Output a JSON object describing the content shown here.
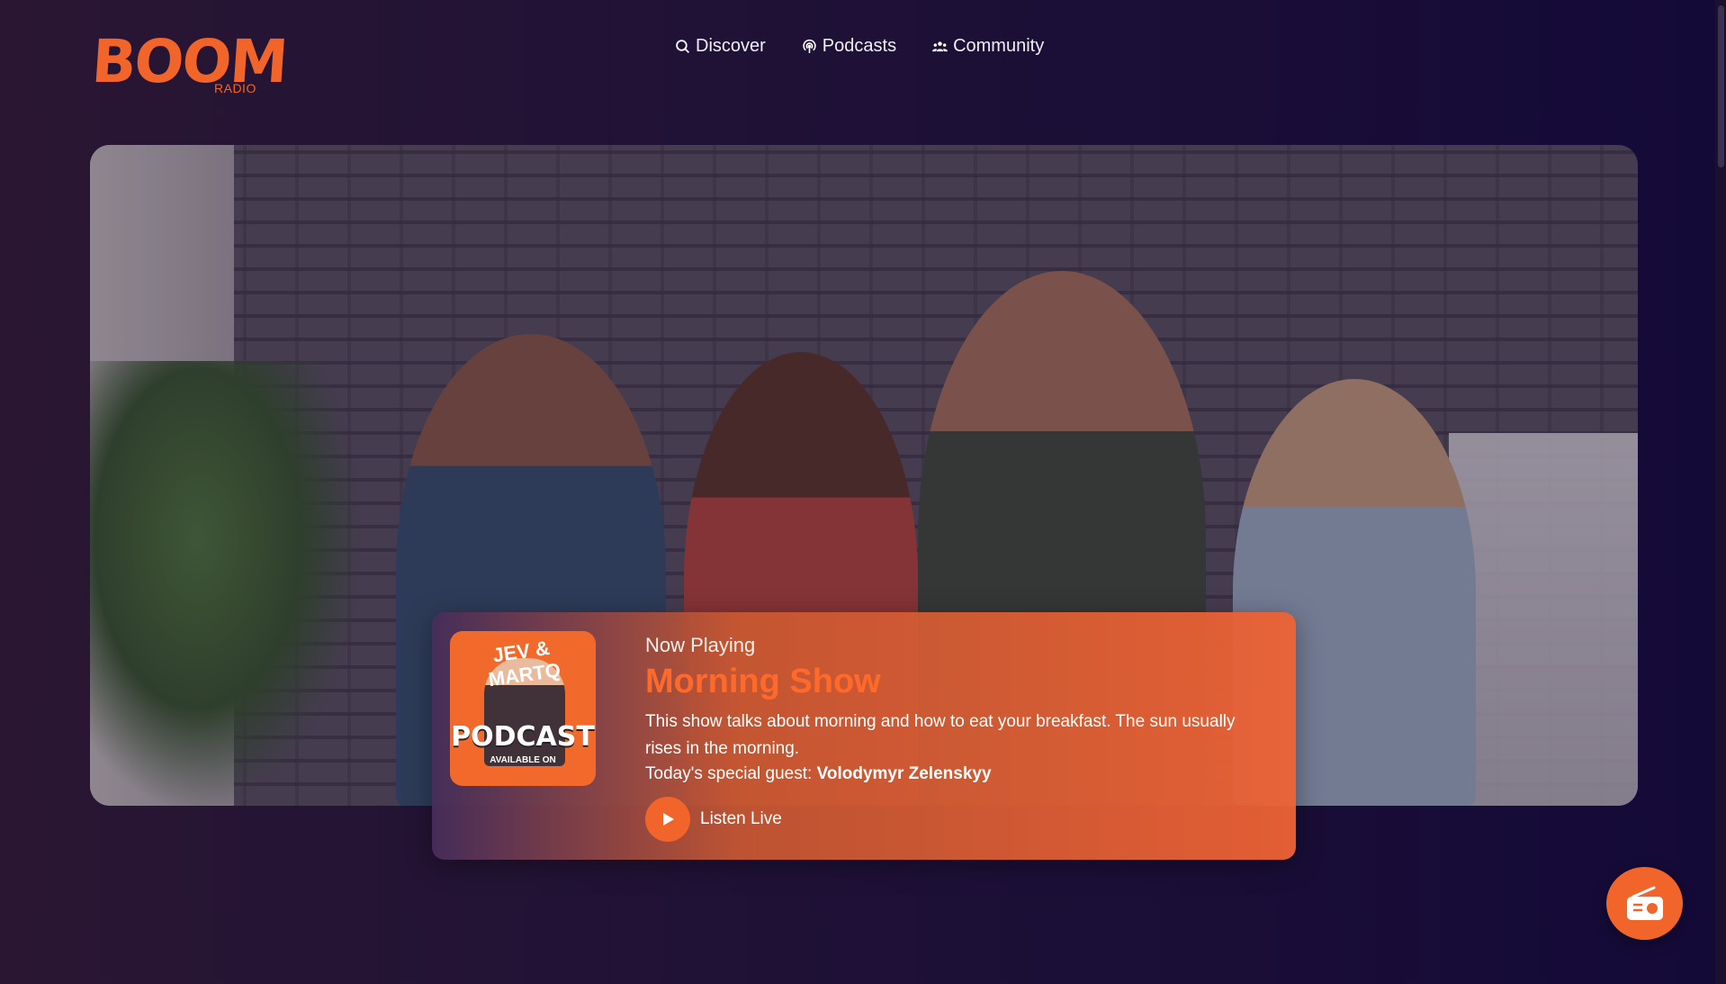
{
  "brand": {
    "logo_text": "BOOM",
    "logo_subtext": "RADIO",
    "accent_color": "#f2652a"
  },
  "nav": {
    "items": [
      {
        "label": "Discover",
        "icon": "search-icon"
      },
      {
        "label": "Podcasts",
        "icon": "podcast-icon"
      },
      {
        "label": "Community",
        "icon": "community-icon"
      }
    ]
  },
  "now_playing": {
    "heading": "Now Playing",
    "title": "Morning Show",
    "description": "This show talks about morning and how to eat your breakfast. The sun usually rises in the morning.",
    "guest_prefix": "Today's special guest:",
    "guest_name": "Volodymyr Zelenskyy",
    "listen_label": "Listen Live",
    "cover": {
      "top_text": "JEV & MARTQ",
      "main_text": "PODCAST",
      "tagline": "AVAILABLE ON"
    }
  },
  "floating_button": {
    "icon": "radio-icon"
  }
}
